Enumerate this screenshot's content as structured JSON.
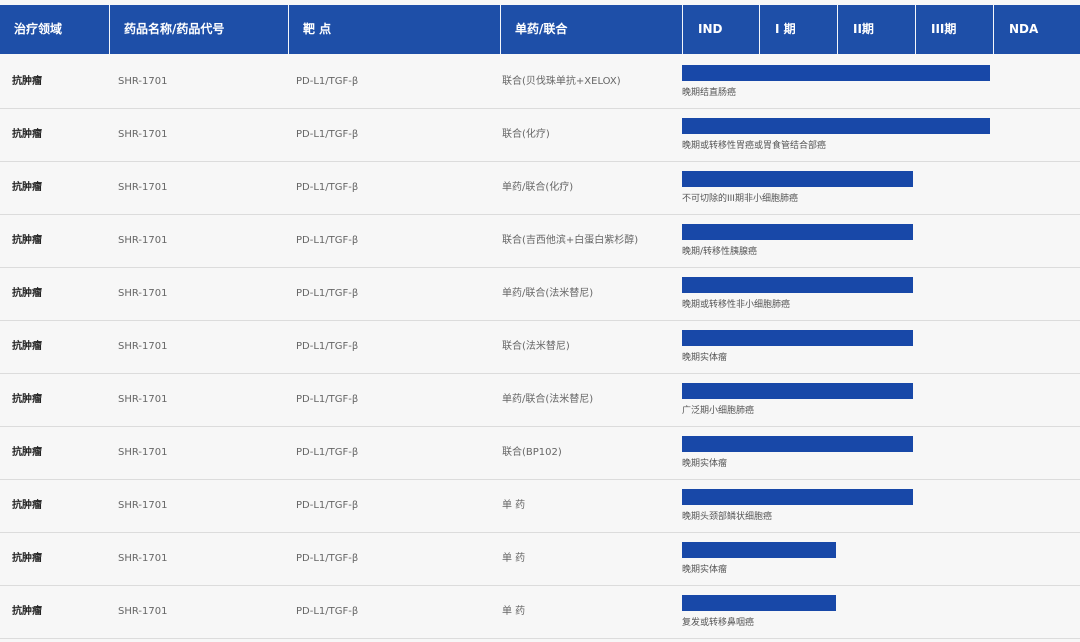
{
  "header": {
    "area": "治疗领域",
    "drug": "药品名称/药品代号",
    "target": "靶 点",
    "mode": "单药/联合",
    "phases": [
      "IND",
      "I 期",
      "II期",
      "III期",
      "NDA"
    ]
  },
  "colors": {
    "header_bg": "#1e4fa8",
    "bar": "#1848a8",
    "background": "#f7f7f7"
  },
  "rows": [
    {
      "area": "抗肿瘤",
      "code": "SHR-1701",
      "target": "PD-L1/TGF-β",
      "mode": "联合(贝伐珠单抗+XELOX)",
      "indication": "晚期结直肠癌",
      "stage": "III期",
      "progress": 0.8
    },
    {
      "area": "抗肿瘤",
      "code": "SHR-1701",
      "target": "PD-L1/TGF-β",
      "mode": "联合(化疗)",
      "indication": "晚期或转移性胃癌或胃食管结合部癌",
      "stage": "III期",
      "progress": 0.8
    },
    {
      "area": "抗肿瘤",
      "code": "SHR-1701",
      "target": "PD-L1/TGF-β",
      "mode": "单药/联合(化疗)",
      "indication": "不可切除的III期非小细胞肺癌",
      "stage": "III期",
      "progress": 0.6
    },
    {
      "area": "抗肿瘤",
      "code": "SHR-1701",
      "target": "PD-L1/TGF-β",
      "mode": "联合(吉西他滨+白蛋白紫杉醇)",
      "indication": "晚期/转移性胰腺癌",
      "stage": "III期",
      "progress": 0.6
    },
    {
      "area": "抗肿瘤",
      "code": "SHR-1701",
      "target": "PD-L1/TGF-β",
      "mode": "单药/联合(法米替尼)",
      "indication": "晚期或转移性非小细胞肺癌",
      "stage": "III期",
      "progress": 0.6
    },
    {
      "area": "抗肿瘤",
      "code": "SHR-1701",
      "target": "PD-L1/TGF-β",
      "mode": "联合(法米替尼)",
      "indication": "晚期实体瘤",
      "stage": "III期",
      "progress": 0.6
    },
    {
      "area": "抗肿瘤",
      "code": "SHR-1701",
      "target": "PD-L1/TGF-β",
      "mode": "单药/联合(法米替尼)",
      "indication": "广泛期小细胞肺癌",
      "stage": "III期",
      "progress": 0.6
    },
    {
      "area": "抗肿瘤",
      "code": "SHR-1701",
      "target": "PD-L1/TGF-β",
      "mode": "联合(BP102)",
      "indication": "晚期实体瘤",
      "stage": "III期",
      "progress": 0.6
    },
    {
      "area": "抗肿瘤",
      "code": "SHR-1701",
      "target": "PD-L1/TGF-β",
      "mode": "单 药",
      "indication": "晚期头颈部鳞状细胞癌",
      "stage": "III期",
      "progress": 0.6
    },
    {
      "area": "抗肿瘤",
      "code": "SHR-1701",
      "target": "PD-L1/TGF-β",
      "mode": "单 药",
      "indication": "晚期实体瘤",
      "stage": "II期",
      "progress": 0.4
    },
    {
      "area": "抗肿瘤",
      "code": "SHR-1701",
      "target": "PD-L1/TGF-β",
      "mode": "单 药",
      "indication": "复发或转移鼻咽癌",
      "stage": "II期",
      "progress": 0.4
    }
  ]
}
